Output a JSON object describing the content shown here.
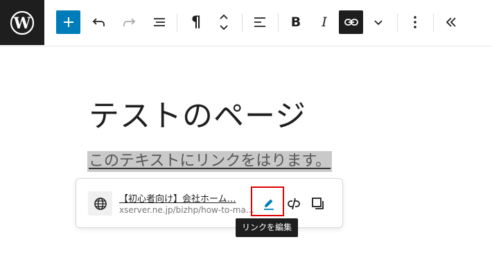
{
  "toolbar": {
    "add_icon": "plus-icon",
    "undo_icon": "undo-icon",
    "redo_icon": "redo-icon",
    "list_view_icon": "list-view-icon",
    "paragraph_icon": "paragraph-icon",
    "move_icon": "chevron-up-down-icon",
    "align_icon": "align-left-icon",
    "bold_label": "B",
    "italic_label": "I",
    "link_icon": "link-icon",
    "more_formats_icon": "chevron-down-icon",
    "options_icon": "more-vertical-icon",
    "collapse_icon": "double-chevron-left-icon",
    "accent_color": "#007cba"
  },
  "editor": {
    "title": "テストのページ",
    "paragraph": "このテキストにリンクをはります。"
  },
  "link_popover": {
    "globe_icon": "globe-icon",
    "title": "【初心者向け】会社ホーム…",
    "url": "xserver.ne.jp/bizhp/how-to-ma…",
    "edit_icon": "pencil-icon",
    "unlink_icon": "unlink-icon",
    "copy_icon": "copy-icon",
    "tooltip": "リンクを編集",
    "highlight_color": "#e00000"
  }
}
